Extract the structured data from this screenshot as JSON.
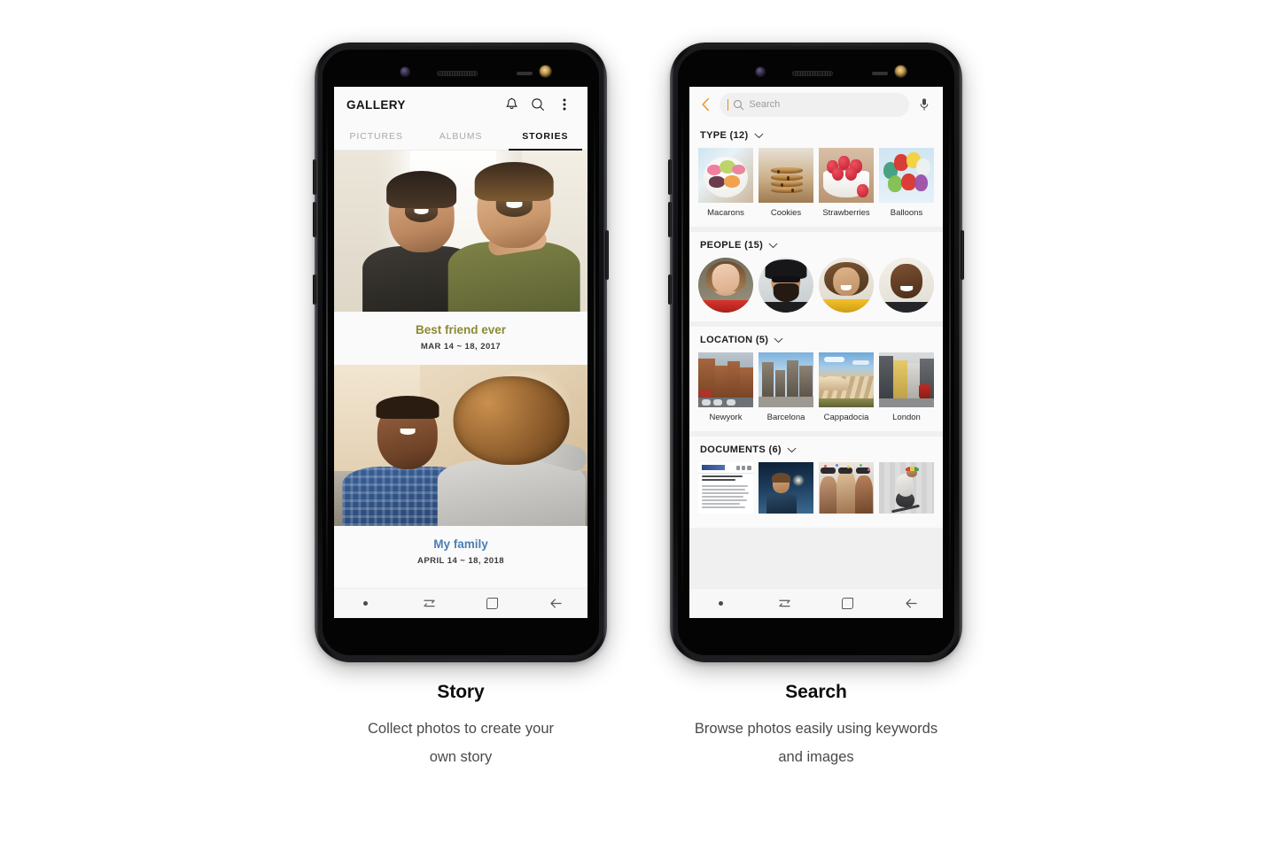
{
  "story_phone": {
    "app_bar": {
      "title": "GALLERY",
      "notification_icon": "bell-icon",
      "search_icon": "search-icon",
      "more_icon": "more-vertical-icon"
    },
    "tabs": [
      {
        "label": "PICTURES",
        "active": false
      },
      {
        "label": "ALBUMS",
        "active": false
      },
      {
        "label": "STORIES",
        "active": true
      }
    ],
    "stories": [
      {
        "title": "Best friend ever",
        "date": "MAR 14 ~ 18, 2017",
        "color": "#8a8a32",
        "photo": "two-men-smiling"
      },
      {
        "title": "My family",
        "date": "APRIL 14 ~ 18, 2018",
        "color": "#4a7fb5",
        "photo": "couple-selfie"
      }
    ],
    "nav_bar": [
      {
        "icon": "dot-icon",
        "name": "nav-dot"
      },
      {
        "icon": "recents-icon",
        "name": "nav-recents"
      },
      {
        "icon": "home-icon",
        "name": "nav-home"
      },
      {
        "icon": "back-arrow-icon",
        "name": "nav-back"
      }
    ]
  },
  "search_phone": {
    "top_bar": {
      "back_icon": "back-chevron-icon",
      "back_color": "#e8942a",
      "search_icon": "search-icon",
      "placeholder": "Search",
      "mic_icon": "microphone-icon"
    },
    "sections": [
      {
        "title": "TYPE (12)",
        "chevron": "chevron-down-icon",
        "kind": "tiles",
        "items": [
          {
            "label": "Macarons",
            "art": "macarons"
          },
          {
            "label": "Cookies",
            "art": "cookies"
          },
          {
            "label": "Strawberries",
            "art": "straw"
          },
          {
            "label": "Balloons",
            "art": "balloons"
          }
        ]
      },
      {
        "title": "PEOPLE (15)",
        "chevron": "chevron-down-icon",
        "kind": "avatars",
        "items": [
          {
            "label": "",
            "art": "person-woman-red"
          },
          {
            "label": "",
            "art": "person-man-sunglasses"
          },
          {
            "label": "",
            "art": "person-woman-yellow"
          },
          {
            "label": "",
            "art": "person-man-bald"
          }
        ]
      },
      {
        "title": "LOCATION (5)",
        "chevron": "chevron-down-icon",
        "kind": "tiles",
        "items": [
          {
            "label": "Newyork",
            "art": "nyc"
          },
          {
            "label": "Barcelona",
            "art": "barca"
          },
          {
            "label": "Cappadocia",
            "art": "capp"
          },
          {
            "label": "London",
            "art": "london"
          }
        ]
      },
      {
        "title": "DOCUMENTS (6)",
        "chevron": "chevron-down-icon",
        "kind": "docs",
        "items": [
          {
            "label": "",
            "art": "doc-art"
          },
          {
            "label": "",
            "art": "kid"
          },
          {
            "label": "",
            "art": "party"
          },
          {
            "label": "",
            "art": "skate"
          }
        ]
      }
    ],
    "nav_bar": [
      {
        "icon": "dot-icon",
        "name": "nav-dot"
      },
      {
        "icon": "recents-icon",
        "name": "nav-recents"
      },
      {
        "icon": "home-icon",
        "name": "nav-home"
      },
      {
        "icon": "back-arrow-icon",
        "name": "nav-back"
      }
    ]
  },
  "captions": {
    "story": {
      "title": "Story",
      "line1": "Collect photos to create your",
      "line2": "own story"
    },
    "search": {
      "title": "Search",
      "line1": "Browse photos easily using keywords",
      "line2": "and images"
    }
  }
}
